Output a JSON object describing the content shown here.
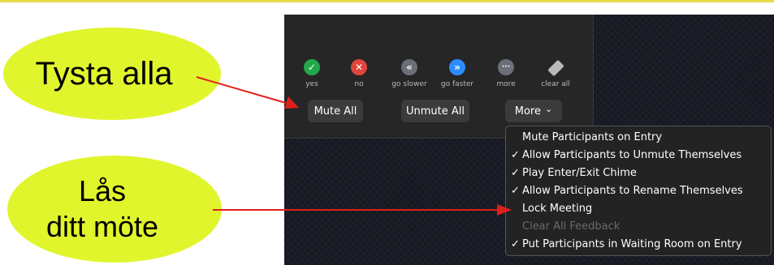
{
  "callouts": {
    "mute": "Tysta alla",
    "lock_line1": "Lås",
    "lock_line2": "ditt möte"
  },
  "reactions": [
    {
      "label": "yes",
      "icon": "check-icon",
      "color": "#22a84a",
      "glyph": "✓"
    },
    {
      "label": "no",
      "icon": "x-icon",
      "color": "#e0453e",
      "glyph": "✕"
    },
    {
      "label": "go slower",
      "icon": "rewind-icon",
      "color": "#6b6f7a",
      "glyph": "«"
    },
    {
      "label": "go faster",
      "icon": "fast-forward-icon",
      "color": "#2d8cff",
      "glyph": "»"
    },
    {
      "label": "more",
      "icon": "ellipsis-icon",
      "color": "#6b6f7a",
      "glyph": "···"
    },
    {
      "label": "clear all",
      "icon": "eraser-icon",
      "color": "#b9b9b9",
      "glyph": ""
    }
  ],
  "buttons": {
    "mute_all": "Mute All",
    "unmute_all": "Unmute All",
    "more": "More",
    "more_chevron": "⌄"
  },
  "menu": {
    "items": [
      {
        "label": "Mute Participants on Entry",
        "checked": false,
        "enabled": true
      },
      {
        "label": "Allow Participants to Unmute Themselves",
        "checked": true,
        "enabled": true
      },
      {
        "label": "Play Enter/Exit Chime",
        "checked": true,
        "enabled": true
      },
      {
        "label": "Allow Participants to Rename Themselves",
        "checked": true,
        "enabled": true
      },
      {
        "label": "Lock Meeting",
        "checked": false,
        "enabled": true
      },
      {
        "label": "Clear All Feedback",
        "checked": false,
        "enabled": false
      },
      {
        "label": "Put Participants in Waiting Room on Entry",
        "checked": true,
        "enabled": true
      }
    ],
    "check_glyph": "✓"
  },
  "colors": {
    "callout": "#e1f52c",
    "arrow": "#e0201b",
    "panel": "#262626"
  }
}
